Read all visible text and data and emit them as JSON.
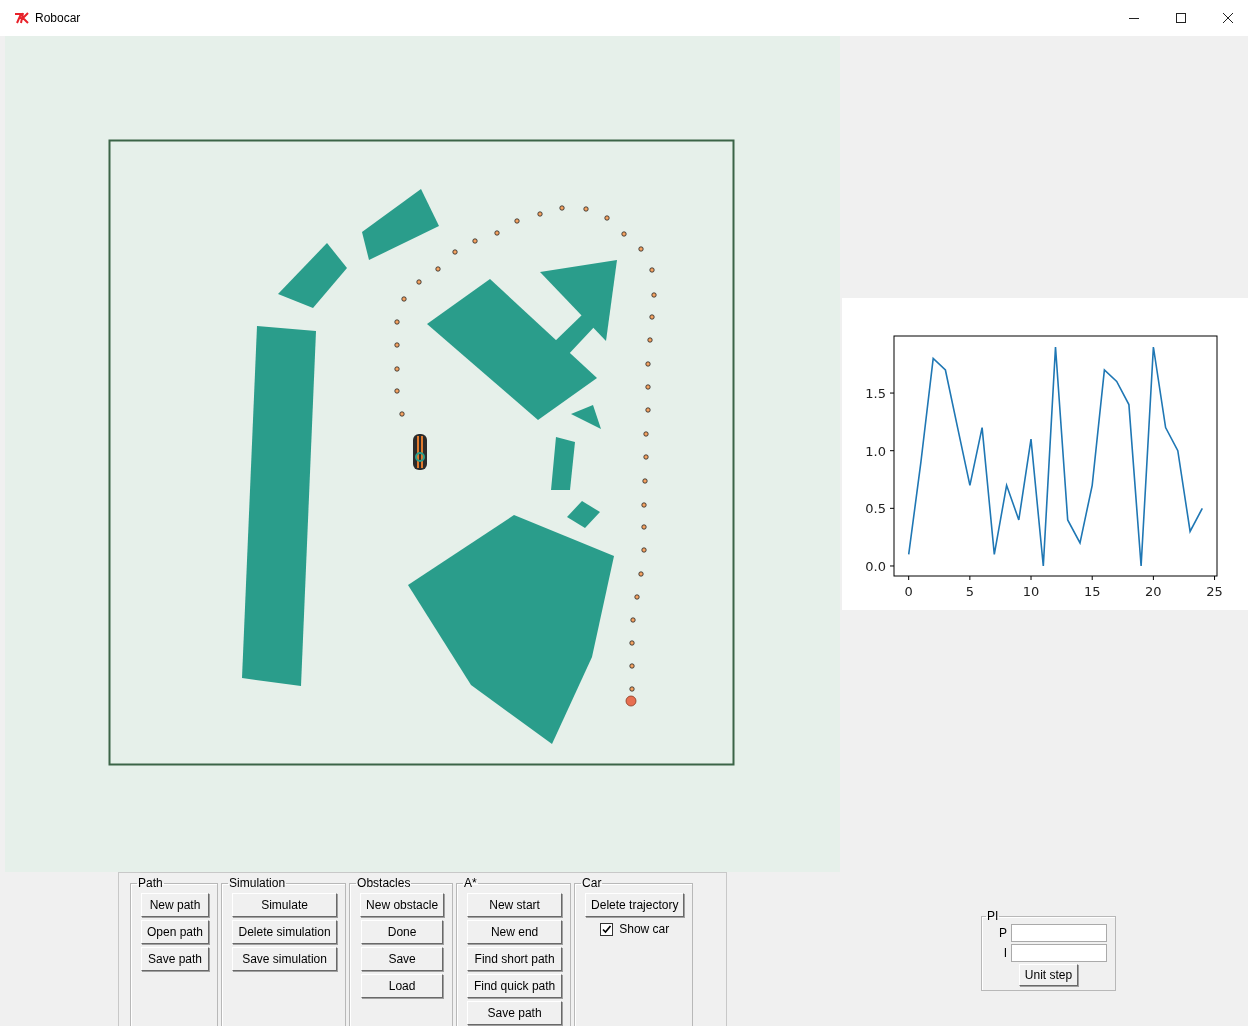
{
  "window": {
    "title": "Robocar"
  },
  "groups": [
    {
      "label": "Path",
      "buttons": [
        "New path",
        "Open path",
        "Save path"
      ]
    },
    {
      "label": "Simulation",
      "buttons": [
        "Simulate",
        "Delete simulation",
        "Save simulation"
      ]
    },
    {
      "label": "Obstacles",
      "buttons": [
        "New obstacle",
        "Done",
        "Save",
        "Load"
      ]
    },
    {
      "label": "A*",
      "buttons": [
        "New start",
        "New end",
        "Find short path",
        "Find quick path",
        "Save path"
      ]
    },
    {
      "label": "Car",
      "buttons": [
        "Delete trajectory"
      ],
      "checkboxes": [
        {
          "label": "Show car",
          "checked": true
        }
      ]
    }
  ],
  "chart": {
    "chart_data": {
      "type": "line",
      "x": [
        0,
        1,
        2,
        3,
        4,
        5,
        6,
        7,
        8,
        9,
        10,
        11,
        12,
        13,
        14,
        15,
        16,
        17,
        18,
        19,
        20,
        21,
        22,
        23,
        24
      ],
      "series": [
        {
          "color": "#1f77b4",
          "values": [
            0.1,
            0.9,
            1.8,
            1.7,
            1.2,
            0.7,
            1.2,
            0.1,
            0.7,
            0.4,
            1.1,
            0.0,
            1.9,
            0.4,
            0.2,
            0.7,
            1.7,
            1.6,
            1.4,
            0.0,
            1.9,
            1.2,
            1.0,
            0.3,
            0.5
          ]
        }
      ],
      "xlim": [
        -1.2,
        25.2
      ],
      "ylim": [
        -0.087,
        1.995
      ],
      "xticks": [
        {
          "value": 0,
          "label": "0"
        },
        {
          "value": 5,
          "label": "5"
        },
        {
          "value": 10,
          "label": "10"
        },
        {
          "value": 15,
          "label": "15"
        },
        {
          "value": 20,
          "label": "20"
        },
        {
          "value": 25,
          "label": "25"
        }
      ],
      "yticks": [
        {
          "value": 0,
          "label": "0.0"
        },
        {
          "value": 0.5,
          "label": "0.5"
        },
        {
          "value": 1,
          "label": "1.0"
        },
        {
          "value": 1.5,
          "label": "1.5"
        }
      ]
    }
  },
  "pi": {
    "label": "PI",
    "fields": [
      {
        "label": "P"
      },
      {
        "label": "I"
      }
    ],
    "button": "Unit step"
  }
}
